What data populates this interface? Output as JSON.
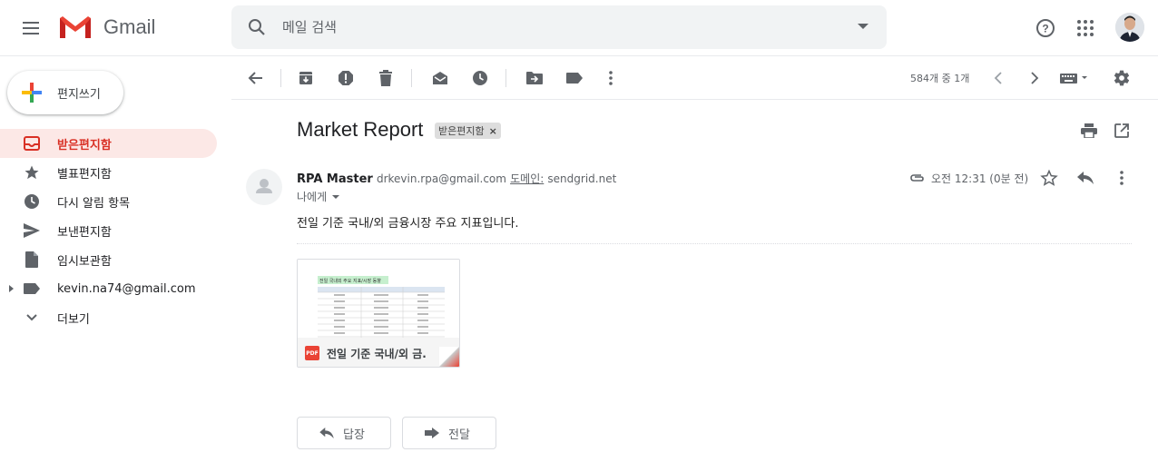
{
  "header": {
    "app_name": "Gmail",
    "search_placeholder": "메일 검색"
  },
  "sidebar": {
    "compose_label": "편지쓰기",
    "items": [
      {
        "label": "받은편지함",
        "icon": "inbox-icon",
        "active": true
      },
      {
        "label": "별표편지함",
        "icon": "star-icon"
      },
      {
        "label": "다시 알림 항목",
        "icon": "clock-icon"
      },
      {
        "label": "보낸편지함",
        "icon": "send-icon"
      },
      {
        "label": "임시보관함",
        "icon": "draft-icon"
      },
      {
        "label": "kevin.na74@gmail.com",
        "icon": "label-icon"
      },
      {
        "label": "더보기",
        "icon": "chevron-down-icon"
      }
    ]
  },
  "toolbar": {
    "page_count": "584개 중 1개"
  },
  "message": {
    "subject": "Market Report",
    "label_chip": "받은편지함",
    "sender_name": "RPA Master",
    "sender_email": "drkevin.rpa@gmail.com",
    "domain_label": "도메인:",
    "domain_value": "sendgrid.net",
    "recipient": "나에게",
    "time": "오전 12:31 (0분 전)",
    "body": "전일 기준 국내/외 금융시장 주요 지표입니다.",
    "attachment_name": "전일 기준 국내/외 금...",
    "attachment_type": "PDF",
    "attachment_preview_title": "전일 국내외 주요 지표/시장 동향"
  },
  "actions": {
    "reply_label": "답장",
    "forward_label": "전달"
  },
  "colors": {
    "accent_red": "#d93025",
    "active_bg": "#fce8e6",
    "search_bg": "#f1f3f4"
  }
}
